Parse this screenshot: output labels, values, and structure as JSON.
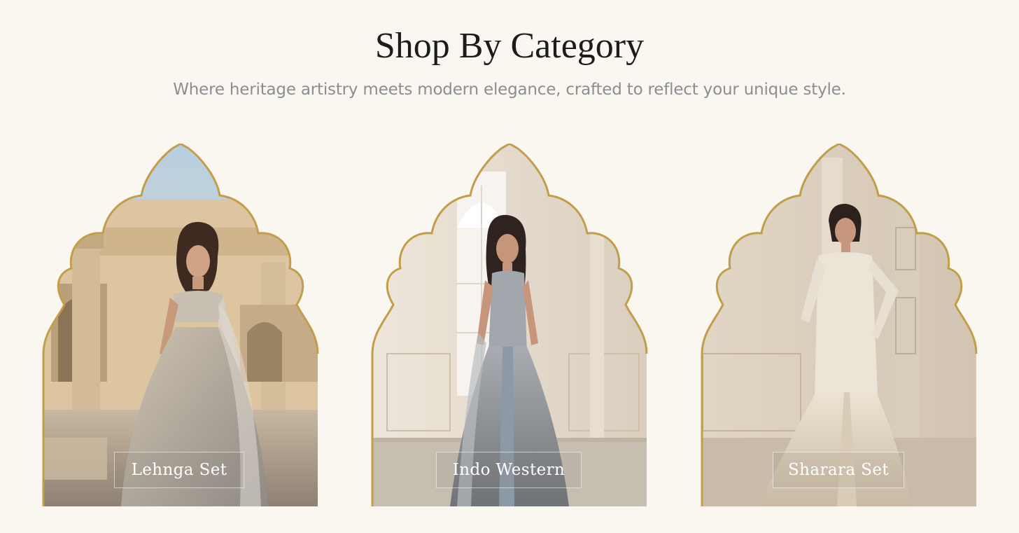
{
  "section": {
    "title": "Shop By Category",
    "subtitle": "Where heritage artistry meets modern elegance, crafted to reflect your unique style."
  },
  "categories": [
    {
      "label": "Lehnga Set",
      "scene": "palace-courtyard",
      "outfit_color": "#b7ad9c"
    },
    {
      "label": "Indo Western",
      "scene": "arched-window-room",
      "outfit_color": "#9ea4ab"
    },
    {
      "label": "Sharara Set",
      "scene": "carved-marble-wall",
      "outfit_color": "#e5dccb"
    }
  ],
  "colors": {
    "page_background": "#faf7f1",
    "arch_border": "#c29d4a",
    "title_text": "#1c1c1c",
    "subtitle_text": "#8b8e90",
    "label_text": "#ffffff"
  }
}
